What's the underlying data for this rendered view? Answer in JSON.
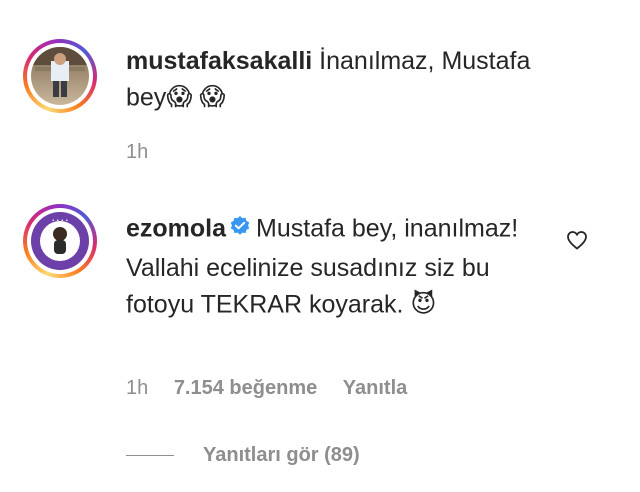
{
  "comments": [
    {
      "username": "mustafaksakalli",
      "text": "İnanılmaz, Mustafa bey",
      "emojis": [
        "😱",
        "😱"
      ],
      "time": "1h",
      "verified": false
    },
    {
      "username": "ezomola",
      "text": "Mustafa bey, inanılmaz! Vallahi ecelinize susadınız siz bu fotoyu TEKRAR koyarak.",
      "emojis": [
        "😈"
      ],
      "time": "1h",
      "likes": "7.154 beğenme",
      "reply_label": "Yanıtla",
      "verified": true
    }
  ],
  "view_replies": "Yanıtları gör (89)",
  "colors": {
    "text": "#262626",
    "secondary": "#8e8e8e",
    "verified": "#3897f0"
  },
  "icons": [
    "heart-outline-icon",
    "verified-badge-icon"
  ]
}
